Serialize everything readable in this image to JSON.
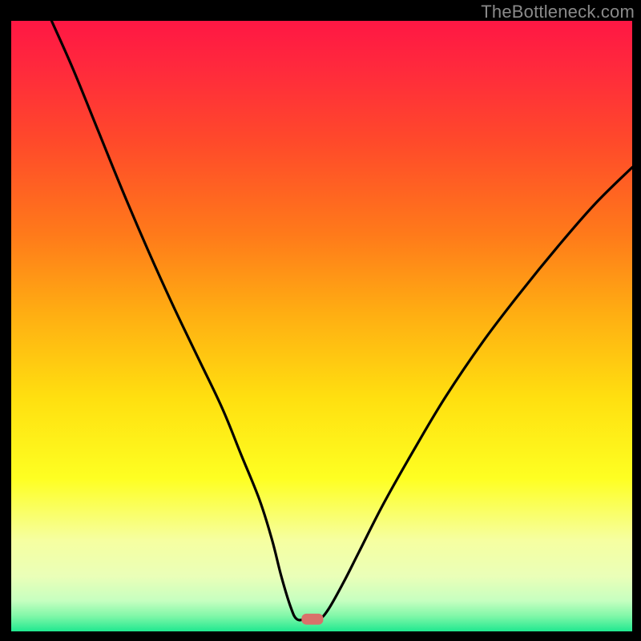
{
  "watermark": "TheBottleneck.com",
  "chart_data": {
    "type": "line",
    "title": "",
    "xlabel": "",
    "ylabel": "",
    "xlim": [
      0,
      100
    ],
    "ylim": [
      0,
      100
    ],
    "legend": false,
    "grid": false,
    "background_gradient_stops": [
      {
        "pos": 0.0,
        "color": "#ff1744"
      },
      {
        "pos": 0.08,
        "color": "#ff2a3c"
      },
      {
        "pos": 0.2,
        "color": "#ff4a2a"
      },
      {
        "pos": 0.35,
        "color": "#ff7a1a"
      },
      {
        "pos": 0.48,
        "color": "#ffae12"
      },
      {
        "pos": 0.62,
        "color": "#ffe010"
      },
      {
        "pos": 0.75,
        "color": "#feff22"
      },
      {
        "pos": 0.85,
        "color": "#f6ffa0"
      },
      {
        "pos": 0.91,
        "color": "#eaffb8"
      },
      {
        "pos": 0.95,
        "color": "#c6ffc0"
      },
      {
        "pos": 0.975,
        "color": "#80f7a8"
      },
      {
        "pos": 1.0,
        "color": "#20e890"
      }
    ],
    "series": [
      {
        "name": "curve",
        "color": "#000000",
        "points": [
          {
            "x": 6.5,
            "y": 100.0
          },
          {
            "x": 10.0,
            "y": 92.0
          },
          {
            "x": 14.0,
            "y": 82.0
          },
          {
            "x": 18.0,
            "y": 72.0
          },
          {
            "x": 22.0,
            "y": 62.5
          },
          {
            "x": 26.0,
            "y": 53.5
          },
          {
            "x": 30.0,
            "y": 45.0
          },
          {
            "x": 34.0,
            "y": 36.5
          },
          {
            "x": 37.0,
            "y": 29.0
          },
          {
            "x": 40.0,
            "y": 21.5
          },
          {
            "x": 42.0,
            "y": 15.0
          },
          {
            "x": 43.5,
            "y": 9.0
          },
          {
            "x": 45.0,
            "y": 4.0
          },
          {
            "x": 46.0,
            "y": 2.0
          },
          {
            "x": 47.5,
            "y": 2.0
          },
          {
            "x": 49.5,
            "y": 2.0
          },
          {
            "x": 51.0,
            "y": 3.5
          },
          {
            "x": 53.5,
            "y": 8.0
          },
          {
            "x": 56.0,
            "y": 13.0
          },
          {
            "x": 60.0,
            "y": 21.0
          },
          {
            "x": 65.0,
            "y": 30.0
          },
          {
            "x": 70.0,
            "y": 38.5
          },
          {
            "x": 76.0,
            "y": 47.5
          },
          {
            "x": 82.0,
            "y": 55.5
          },
          {
            "x": 88.0,
            "y": 63.0
          },
          {
            "x": 94.0,
            "y": 70.0
          },
          {
            "x": 100.0,
            "y": 76.0
          }
        ]
      }
    ],
    "marker": {
      "name": "bottleneck-marker",
      "x": 48.5,
      "y": 2.0,
      "color": "#d9716a",
      "width": 3.5,
      "height": 1.8
    }
  }
}
